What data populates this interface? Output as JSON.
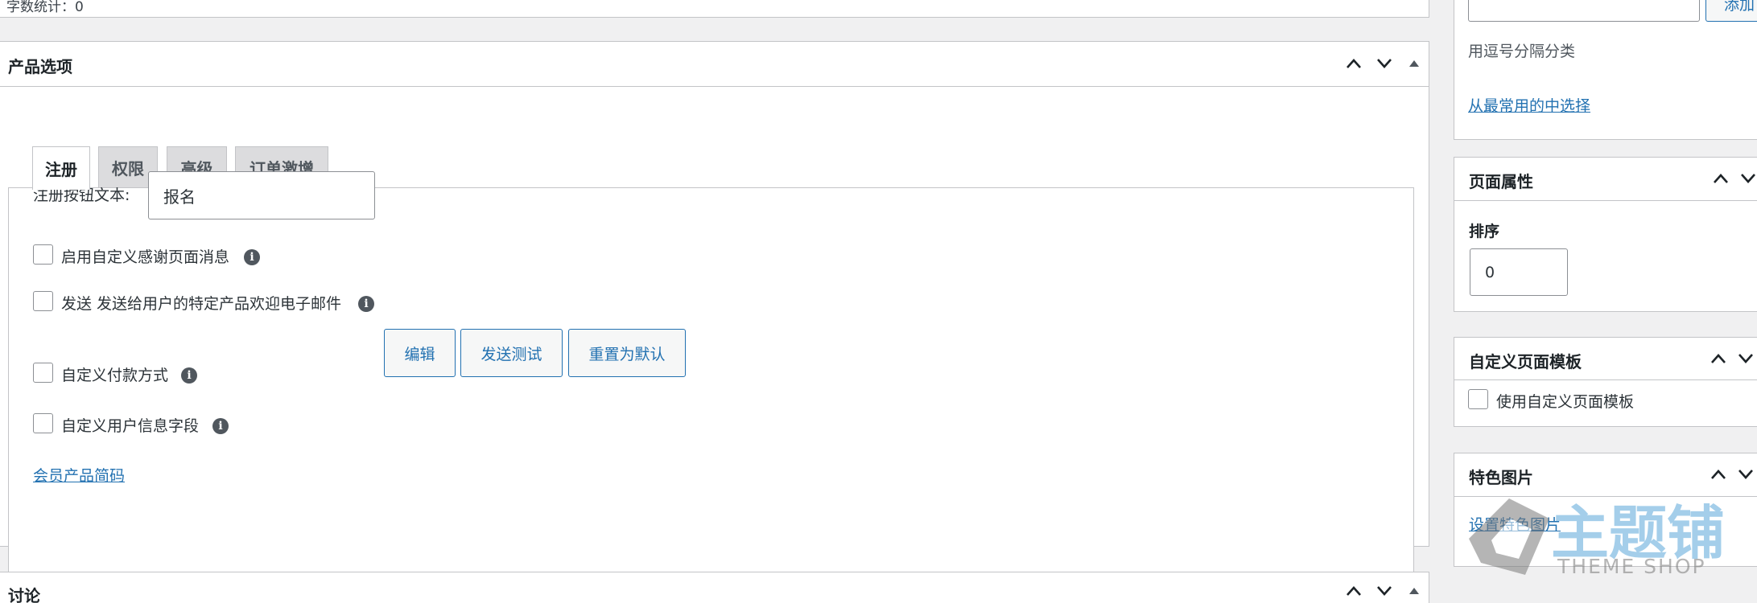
{
  "editor": {
    "word_count": "字数统计：0"
  },
  "product_options": {
    "title": "产品选项",
    "tabs": [
      {
        "label": "注册"
      },
      {
        "label": "权限"
      },
      {
        "label": "高级"
      },
      {
        "label": "订单激增"
      }
    ],
    "register_button_label": "注册按钮文本:",
    "register_button_value": "报名",
    "options": [
      {
        "label": "启用自定义感谢页面消息"
      },
      {
        "label": "发送 发送给用户的特定产品欢迎电子邮件"
      },
      {
        "label": "自定义付款方式"
      },
      {
        "label": "自定义用户信息字段"
      }
    ],
    "email_buttons": {
      "edit": "编辑",
      "send_test": "发送测试",
      "reset": "重置为默认"
    },
    "shortcode_link": "会员产品简码"
  },
  "discussion": {
    "title": "讨论"
  },
  "sidebar": {
    "tags": {
      "add_button": "添加",
      "hint": "用逗号分隔分类",
      "choose_link": "从最常用的中选择"
    },
    "page_attributes": {
      "title": "页面属性",
      "order_label": "排序",
      "order_value": "0"
    },
    "custom_template": {
      "title": "自定义页面模板",
      "checkbox_label": "使用自定义页面模板"
    },
    "featured_image": {
      "title": "特色图片",
      "set_link": "设置特色图片"
    }
  },
  "watermark": {
    "text_cn": "主题铺",
    "text_en": "THEME SHOP"
  },
  "colors": {
    "link": "#2271b1",
    "border": "#c3c4c7",
    "background": "#f0f0f1",
    "watermark_blue": "#5aa7d9"
  }
}
